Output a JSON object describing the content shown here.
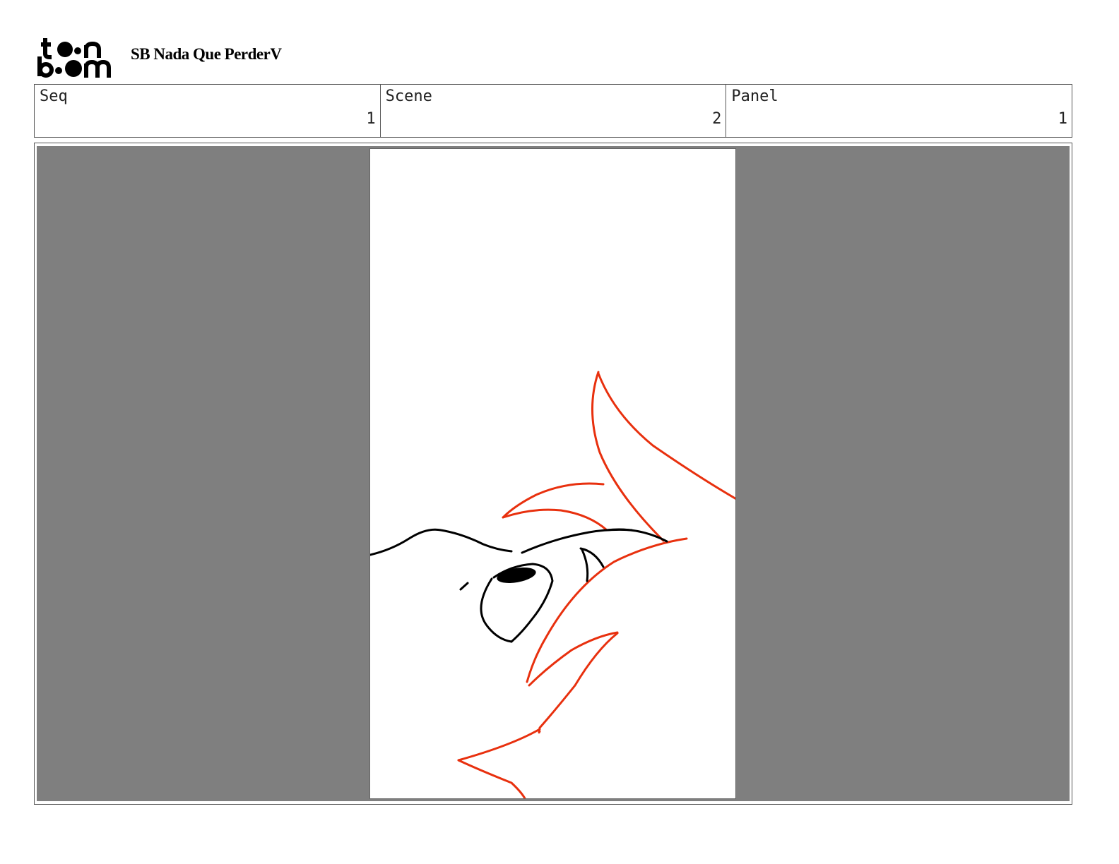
{
  "header": {
    "logo_text": "toon boom",
    "project_title": "SB Nada Que PerderV"
  },
  "info": {
    "seq_label": "Seq",
    "seq_value": "1",
    "scene_label": "Scene",
    "scene_value": "2",
    "panel_label": "Panel",
    "panel_value": "1"
  },
  "colors": {
    "frame_background": "#7f7f7f",
    "sketch_red": "#e8300e",
    "sketch_black": "#000000"
  }
}
